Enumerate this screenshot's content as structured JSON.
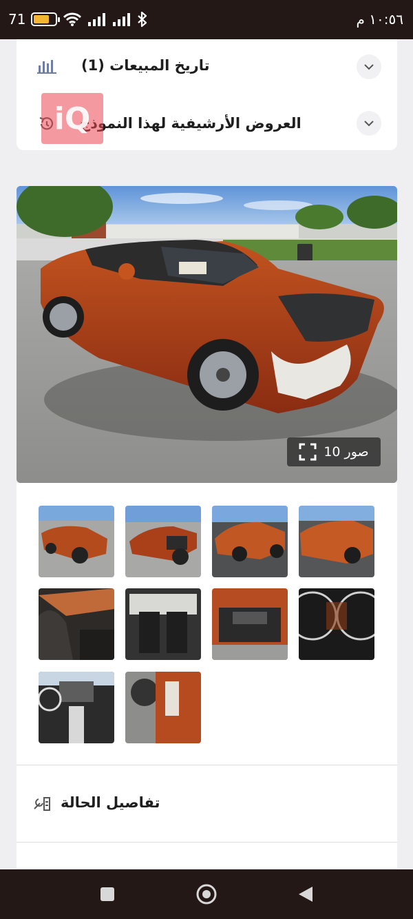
{
  "status_bar": {
    "time": "١٠:٥٦ م",
    "battery_level": "71",
    "battery_fill_fraction": 0.71
  },
  "accordion": {
    "items": [
      {
        "label": "تاريخ المبيعات (1)",
        "icon": "bar-chart-icon"
      },
      {
        "label": "العروض الأرشيفية لهذا النموذج",
        "icon": "history-icon"
      }
    ]
  },
  "watermark": {
    "text": "iQ"
  },
  "hero": {
    "photo_count_label": "صور 10",
    "image": "orange-car-front-damage"
  },
  "gallery": {
    "thumbnails": [
      "front-left-exterior",
      "front-damage-exterior",
      "rear-right-exterior",
      "rear-left-exterior",
      "driver-seat-interior",
      "rear-seats-interior",
      "engine-bay",
      "instrument-cluster",
      "dashboard-interior",
      "door-jamb-label"
    ]
  },
  "condition": {
    "title": "تفاصيل الحالة",
    "icon": "wrench-tools-icon"
  },
  "colors": {
    "accent_car": "#b5441c",
    "status_bar": "#231815"
  }
}
